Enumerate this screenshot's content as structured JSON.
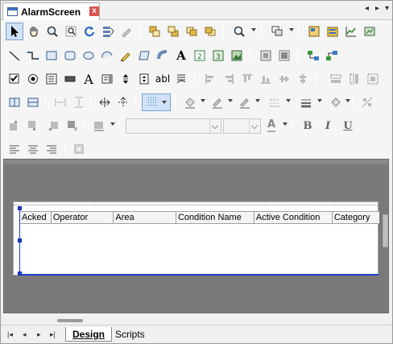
{
  "window": {
    "tab_title": "AlarmScreen",
    "close_glyph": "x",
    "nav_prev": "◂",
    "nav_next": "▸",
    "menu_glyph": "▾"
  },
  "toolbar": {
    "text_tool_glyph": "A",
    "bold_label": "B",
    "italic_label": "I",
    "underline_label": "U",
    "text_box_glyph": "abl",
    "font_color_glyph": "A",
    "font_name_value": "",
    "font_size_value": ""
  },
  "alarm_table": {
    "columns": [
      "Acked",
      "Operator",
      "Area",
      "Condition Name",
      "Active Condition",
      "Category"
    ]
  },
  "bottom_tabs": {
    "design_label": "Design",
    "scripts_label": "Scripts",
    "nav_first": "|◂",
    "nav_prev": "◂",
    "nav_next": "▸",
    "nav_last": "▸|"
  }
}
